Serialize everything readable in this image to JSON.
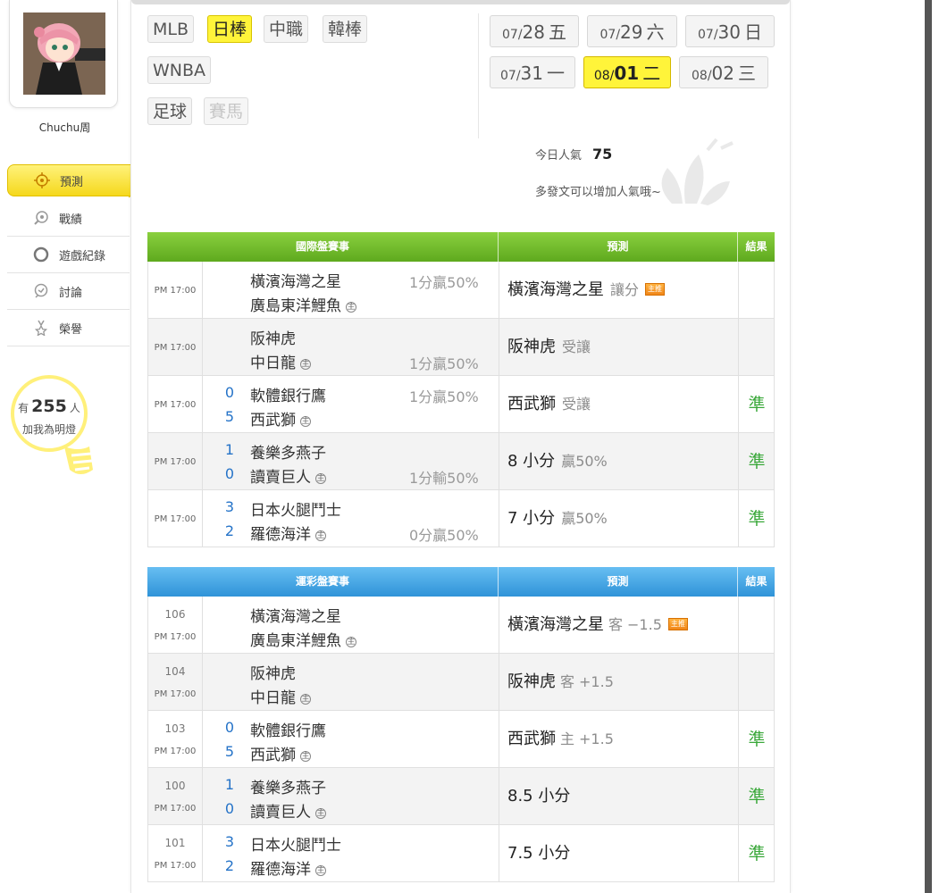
{
  "user": {
    "name": "Chuchu周"
  },
  "sidebar": {
    "items": [
      {
        "label": "預測",
        "icon": "target-icon",
        "active": true
      },
      {
        "label": "戰績",
        "icon": "ranking-icon",
        "active": false
      },
      {
        "label": "遊戲紀錄",
        "icon": "record-icon",
        "active": false
      },
      {
        "label": "討論",
        "icon": "discussion-icon",
        "active": false
      },
      {
        "label": "榮譽",
        "icon": "medal-icon",
        "active": false
      }
    ],
    "followers": {
      "prefix": "有",
      "count": "255",
      "suffix": "人",
      "caption": "加我為明燈"
    }
  },
  "sports": {
    "tabs": [
      {
        "label": "MLB",
        "state": "normal"
      },
      {
        "label": "日棒",
        "state": "active"
      },
      {
        "label": "中職",
        "state": "normal"
      },
      {
        "label": "韓棒",
        "state": "normal"
      },
      {
        "label": "WNBA",
        "state": "normal"
      },
      {
        "label": "足球",
        "state": "normal"
      },
      {
        "label": "賽馬",
        "state": "disabled"
      }
    ]
  },
  "dates": [
    {
      "month": "07/",
      "day": "28",
      "weekday": "五",
      "active": false
    },
    {
      "month": "07/",
      "day": "29",
      "weekday": "六",
      "active": false
    },
    {
      "month": "07/",
      "day": "30",
      "weekday": "日",
      "active": false
    },
    {
      "month": "07/",
      "day": "31",
      "weekday": "一",
      "active": false
    },
    {
      "month": "08/",
      "day": "01",
      "weekday": "二",
      "active": true
    },
    {
      "month": "08/",
      "day": "02",
      "weekday": "三",
      "active": false
    }
  ],
  "popularity": {
    "label": "今日人氣",
    "value": "75",
    "hint": "多發文可以增加人氣哦~"
  },
  "international": {
    "headers": {
      "match": "國際盤賽事",
      "prediction": "預測",
      "result": "結果"
    },
    "rows": [
      {
        "time": "PM 17:00",
        "away": "橫濱海灣之星",
        "home": "廣島東洋鯉魚",
        "away_score": "",
        "home_score": "",
        "line": "1分贏50%",
        "line_on": "away",
        "pick": "橫濱海灣之星",
        "pick_note": "讓分",
        "badge": "主推",
        "result": ""
      },
      {
        "time": "PM 17:00",
        "away": "阪神虎",
        "home": "中日龍",
        "away_score": "",
        "home_score": "",
        "line": "1分贏50%",
        "line_on": "home",
        "pick": "阪神虎",
        "pick_note": "受讓",
        "badge": "",
        "result": ""
      },
      {
        "time": "PM 17:00",
        "away": "軟體銀行鷹",
        "home": "西武獅",
        "away_score": "0",
        "home_score": "5",
        "line": "1分贏50%",
        "line_on": "away",
        "pick": "西武獅",
        "pick_note": "受讓",
        "badge": "",
        "result": "準"
      },
      {
        "time": "PM 17:00",
        "away": "養樂多燕子",
        "home": "讀賣巨人",
        "away_score": "1",
        "home_score": "0",
        "line": "1分輸50%",
        "line_on": "home",
        "pick": "8 小分",
        "pick_note": "贏50%",
        "badge": "",
        "result": "準"
      },
      {
        "time": "PM 17:00",
        "away": "日本火腿鬥士",
        "home": "羅德海洋",
        "away_score": "3",
        "home_score": "2",
        "line": "0分贏50%",
        "line_on": "home",
        "pick": "7 小分",
        "pick_note": "贏50%",
        "badge": "",
        "result": "準"
      }
    ]
  },
  "sportslottery": {
    "headers": {
      "match": "運彩盤賽事",
      "prediction": "預測",
      "result": "結果"
    },
    "rows": [
      {
        "id": "106",
        "time": "PM 17:00",
        "away": "橫濱海灣之星",
        "home": "廣島東洋鯉魚",
        "away_score": "",
        "home_score": "",
        "pick": "橫濱海灣之星",
        "side": "客",
        "spread": "−1.5",
        "badge": "主推",
        "result": ""
      },
      {
        "id": "104",
        "time": "PM 17:00",
        "away": "阪神虎",
        "home": "中日龍",
        "away_score": "",
        "home_score": "",
        "pick": "阪神虎",
        "side": "客",
        "spread": "+1.5",
        "badge": "",
        "result": ""
      },
      {
        "id": "103",
        "time": "PM 17:00",
        "away": "軟體銀行鷹",
        "home": "西武獅",
        "away_score": "0",
        "home_score": "5",
        "pick": "西武獅",
        "side": "主",
        "spread": "+1.5",
        "badge": "",
        "result": "準"
      },
      {
        "id": "100",
        "time": "PM 17:00",
        "away": "養樂多燕子",
        "home": "讀賣巨人",
        "away_score": "1",
        "home_score": "0",
        "pick": "8.5 小分",
        "side": "",
        "spread": "",
        "badge": "",
        "result": "準"
      },
      {
        "id": "101",
        "time": "PM 17:00",
        "away": "日本火腿鬥士",
        "home": "羅德海洋",
        "away_score": "3",
        "home_score": "2",
        "pick": "7.5 小分",
        "side": "",
        "spread": "",
        "badge": "",
        "result": "準"
      }
    ]
  },
  "home_marker": "主"
}
